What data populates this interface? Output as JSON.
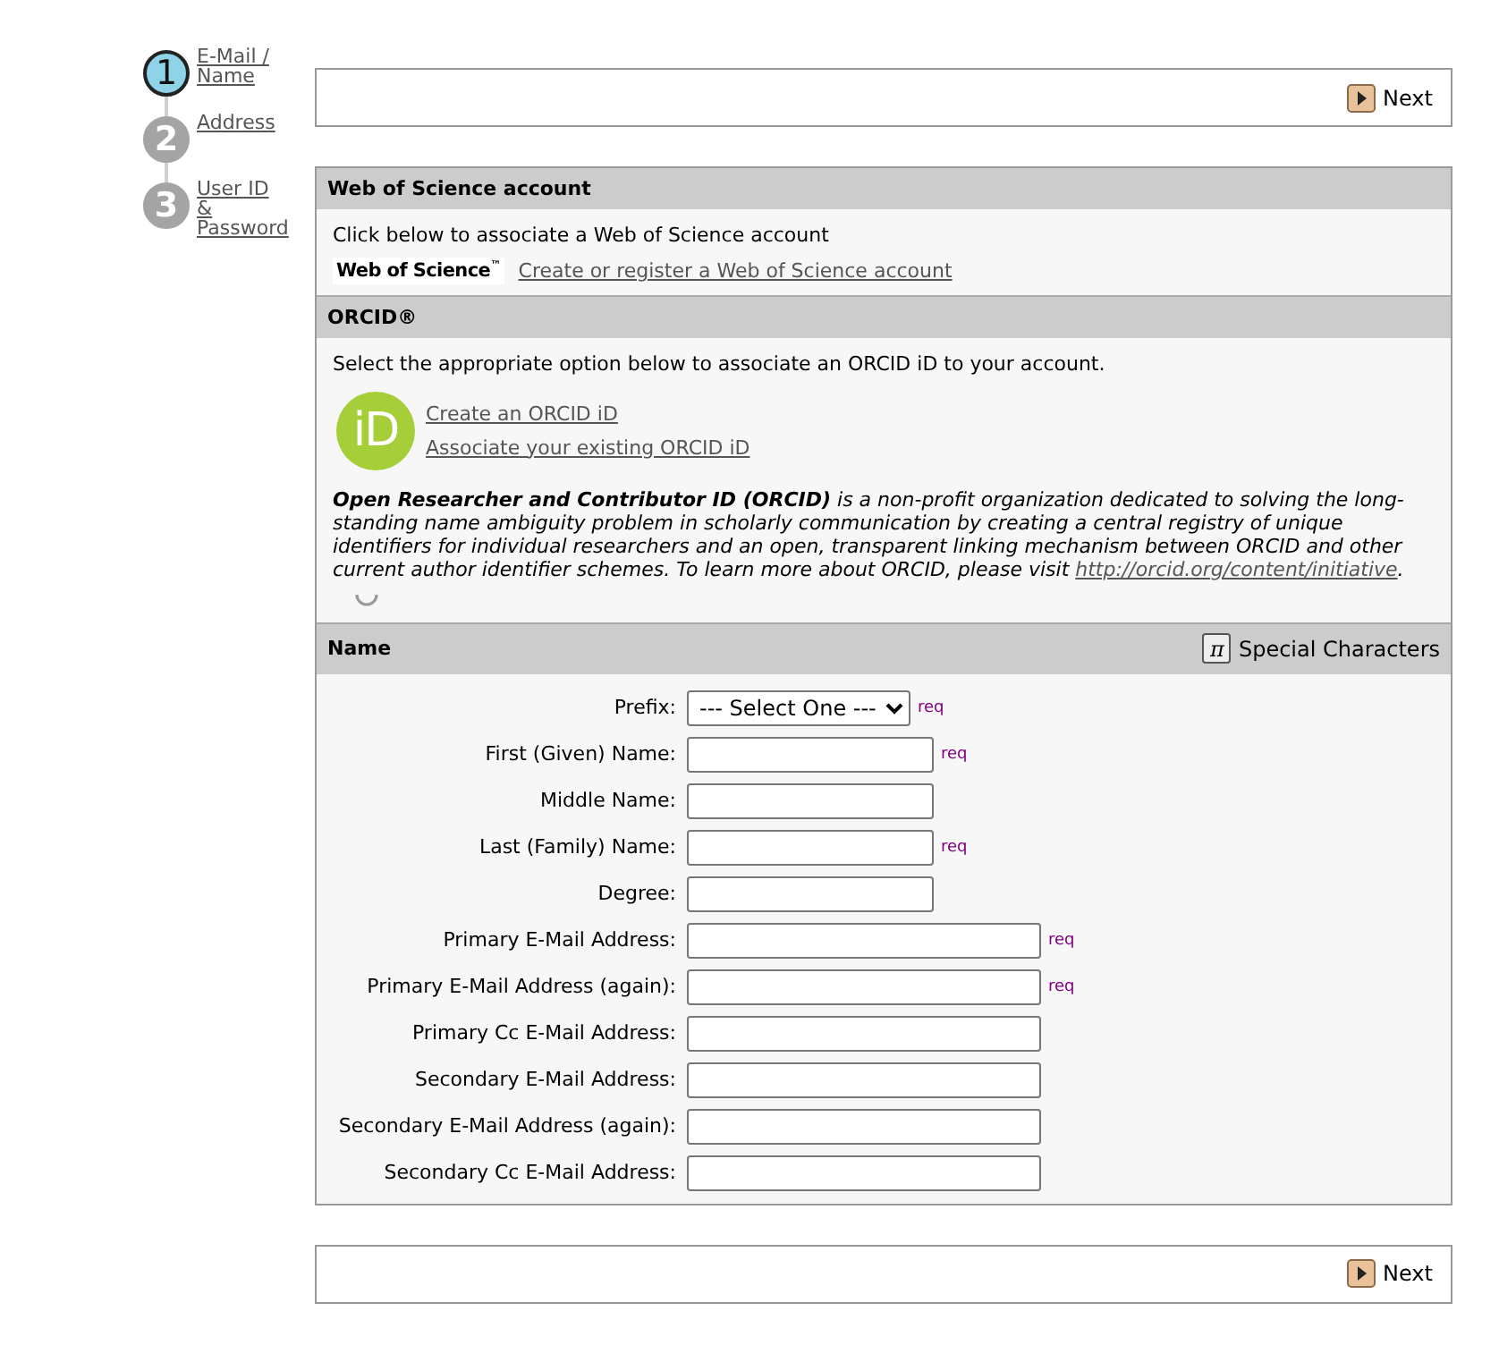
{
  "steps": [
    {
      "number": "1",
      "label": "E-Mail / Name",
      "selected": true
    },
    {
      "number": "2",
      "label": "Address",
      "selected": false
    },
    {
      "number": "3",
      "label": "User ID & Password",
      "selected": false
    }
  ],
  "top_bar": {
    "button": "Next"
  },
  "wos": {
    "title": "Web of Science account",
    "intro": "Click below to associate a Web of Science account",
    "logo": "Web of Science$^{™}$",
    "link": "Create or register a Web of Science account"
  },
  "orcid": {
    "title": "ORCID®",
    "intro": "Select the appropriate option below to associate an ORCID iD to your account.",
    "logo": "iD",
    "links": [
      "Create an ORCID iD",
      "Associate your existing ORCID iD"
    ],
    "description": "**Open Researcher and Contributor ID (ORCID)** is a non-profit organization dedicated to solving the long-standing name ambiguity problem in scholarly communication by creating a central registry of unique identifiers for individual researchers and an open, transparent linking mechanism between ORCID and other current author identifier schemes. To learn more about ORCID, please visit ",
    "description_link": "http://orcid.org/content/initiative",
    "description_end": "."
  },
  "name_section": {
    "title": "Name",
    "special_button": {
      "icon": "π",
      "label": "Special Characters"
    },
    "fields": [
      {
        "label": "Prefix:",
        "kind": "select",
        "value": "--- Select One ---",
        "note": "req"
      },
      {
        "label": "First (Given) Name:",
        "kind": "name",
        "note": "req"
      },
      {
        "label": "Middle Name:",
        "kind": "name"
      },
      {
        "label": "Last (Family) Name:",
        "kind": "name",
        "note": "req"
      },
      {
        "label": "Degree:",
        "kind": "name"
      },
      {
        "label": "Primary E-Mail Address:",
        "kind": "email",
        "note": "req"
      },
      {
        "label": "Primary E-Mail Address (again):",
        "kind": "email",
        "note": "req"
      },
      {
        "label": "Primary Cc E-Mail Address:",
        "kind": "email"
      },
      {
        "label": "Secondary E-Mail Address:",
        "kind": "email"
      },
      {
        "label": "Secondary E-Mail Address (again):",
        "kind": "email"
      },
      {
        "label": "Secondary Cc E-Mail Address:",
        "kind": "email"
      }
    ]
  },
  "bottom_bar": {
    "button": "Next"
  }
}
